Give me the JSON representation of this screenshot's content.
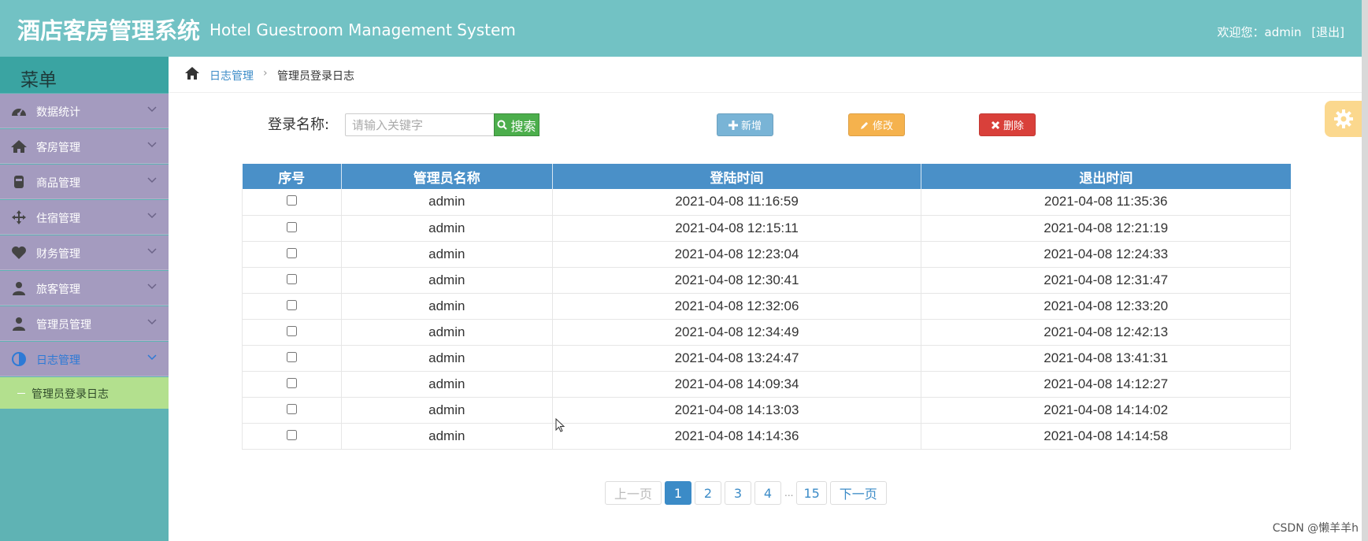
{
  "header": {
    "title_cn": "酒店客房管理系统",
    "title_en": "Hotel Guestroom Management System",
    "welcome": "欢迎您：admin",
    "logout": "[退出]",
    "bg_color": "#72c2c4"
  },
  "sidebar": {
    "menu_title": "菜单",
    "items": [
      {
        "label": "数据统计",
        "icon": "dashboard-icon"
      },
      {
        "label": "客房管理",
        "icon": "home-icon"
      },
      {
        "label": "商品管理",
        "icon": "cup-icon"
      },
      {
        "label": "住宿管理",
        "icon": "move-icon"
      },
      {
        "label": "财务管理",
        "icon": "heart-icon"
      },
      {
        "label": "旅客管理",
        "icon": "user-icon"
      },
      {
        "label": "管理员管理",
        "icon": "user-icon"
      },
      {
        "label": "日志管理",
        "icon": "contrast-icon",
        "active": true
      }
    ],
    "subitems": [
      {
        "label": "管理员登录日志"
      }
    ]
  },
  "breadcrumb": {
    "link": "日志管理",
    "current": "管理员登录日志"
  },
  "search": {
    "label": "登录名称:",
    "placeholder": "请输入关键字",
    "button": "搜索"
  },
  "actions": {
    "add": "新增",
    "edit": "修改",
    "delete": "删除"
  },
  "table": {
    "headers": [
      "序号",
      "管理员名称",
      "登陆时间",
      "退出时间"
    ],
    "rows": [
      {
        "name": "admin",
        "login": "2021-04-08 11:16:59",
        "logout": "2021-04-08 11:35:36"
      },
      {
        "name": "admin",
        "login": "2021-04-08 12:15:11",
        "logout": "2021-04-08 12:21:19"
      },
      {
        "name": "admin",
        "login": "2021-04-08 12:23:04",
        "logout": "2021-04-08 12:24:33"
      },
      {
        "name": "admin",
        "login": "2021-04-08 12:30:41",
        "logout": "2021-04-08 12:31:47"
      },
      {
        "name": "admin",
        "login": "2021-04-08 12:32:06",
        "logout": "2021-04-08 12:33:20"
      },
      {
        "name": "admin",
        "login": "2021-04-08 12:34:49",
        "logout": "2021-04-08 12:42:13"
      },
      {
        "name": "admin",
        "login": "2021-04-08 13:24:47",
        "logout": "2021-04-08 13:41:31"
      },
      {
        "name": "admin",
        "login": "2021-04-08 14:09:34",
        "logout": "2021-04-08 14:12:27"
      },
      {
        "name": "admin",
        "login": "2021-04-08 14:13:03",
        "logout": "2021-04-08 14:14:02"
      },
      {
        "name": "admin",
        "login": "2021-04-08 14:14:36",
        "logout": "2021-04-08 14:14:58"
      }
    ]
  },
  "pagination": {
    "prev": "上一页",
    "pages": [
      "1",
      "2",
      "3",
      "4"
    ],
    "ellipsis": "...",
    "last": "15",
    "next": "下一页",
    "current": "1"
  },
  "watermark": "CSDN @懒羊羊h",
  "colors": {
    "sidebar": "#5fb3b4",
    "menu_item": "#a49bbf",
    "submenu": "#b3e08e",
    "table_header": "#4a90c8",
    "add_btn": "#79b4d6",
    "edit_btn": "#f5b24d",
    "delete_btn": "#d9403a",
    "search_btn": "#4cae4c"
  }
}
